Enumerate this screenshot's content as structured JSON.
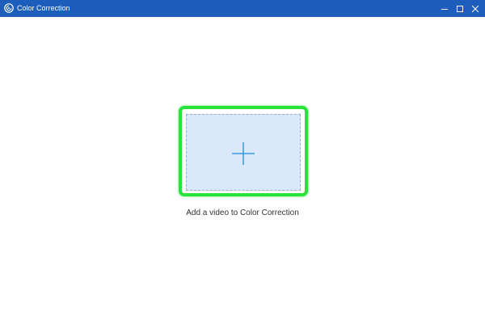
{
  "window": {
    "title": "Color Correction",
    "app_icon": "app-logo-icon",
    "controls": {
      "minimize_icon": "minimize-icon",
      "maximize_icon": "maximize-icon",
      "close_icon": "close-icon"
    }
  },
  "main": {
    "drop_zone": {
      "icon": "plus-icon",
      "caption": "Add a video to Color Correction"
    }
  },
  "colors": {
    "titlebar": "#1d5dbb",
    "highlight_border": "#29e33a",
    "drop_fill": "#d9e9fb",
    "plus": "#1f8fd6"
  }
}
